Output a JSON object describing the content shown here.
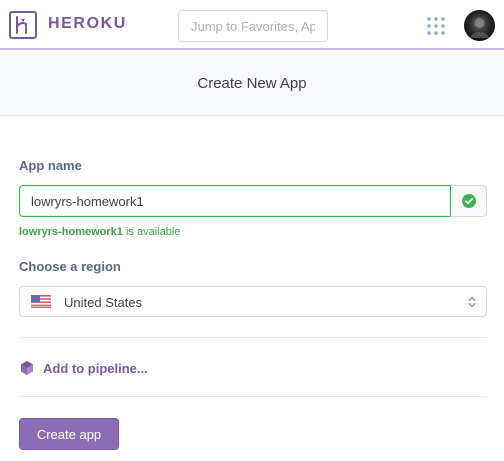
{
  "header": {
    "brand": "HEROKU",
    "search_placeholder": "Jump to Favorites, Ap",
    "apps_icon": "grid-dots-icon",
    "avatar_icon": "user-avatar"
  },
  "page": {
    "title": "Create New App"
  },
  "form": {
    "app_name_label": "App name",
    "app_name_value": "lowryrs-homework1",
    "availability": {
      "name": "lowryrs-homework1",
      "suffix": " is available",
      "status_icon": "check-circle-icon"
    },
    "region_label": "Choose a region",
    "region_value": "United States",
    "region_flag_icon": "us-flag-icon",
    "pipeline_label": "Add to pipeline...",
    "pipeline_icon": "pipeline-hexagon-icon",
    "create_button": "Create app"
  },
  "colors": {
    "brand_purple": "#79589f",
    "success_green": "#3ba14a",
    "button_purple": "#8c6db5"
  }
}
